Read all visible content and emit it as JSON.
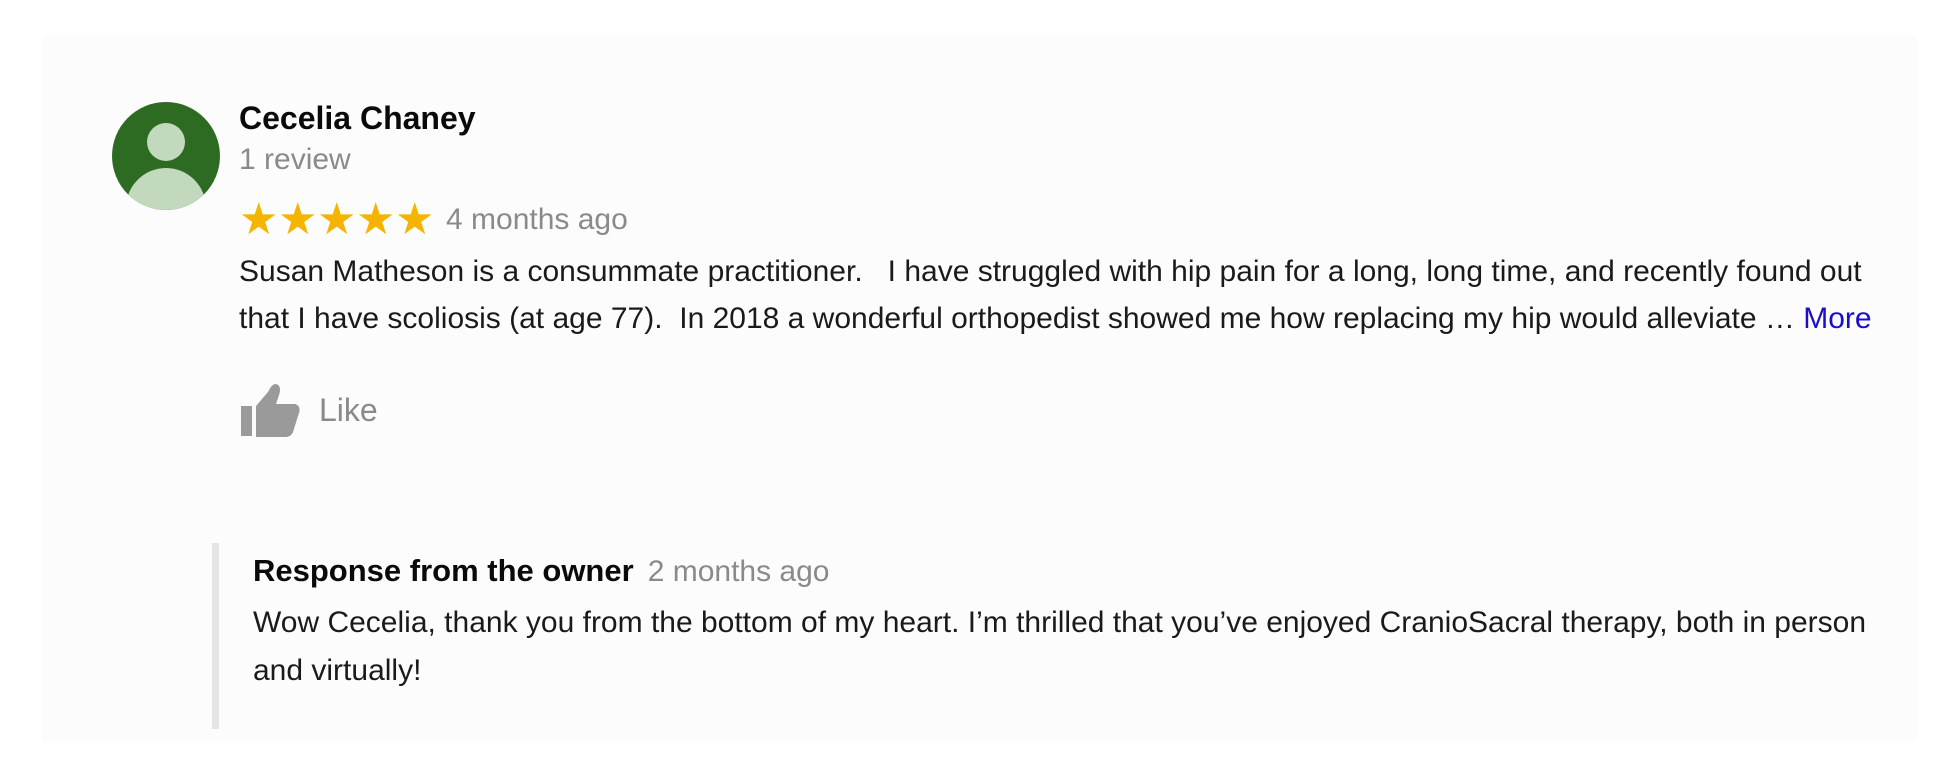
{
  "review": {
    "reviewer_name": "Cecelia Chaney",
    "review_count": "1 review",
    "rating": 5,
    "stars": [
      "★",
      "★",
      "★",
      "★",
      "★"
    ],
    "star_color": "#f5b400",
    "time_ago": "4 months ago",
    "text": "Susan Matheson is a consummate practitioner.   I have struggled with hip pain for a long, long time, and recently found out that I have scoliosis (at age 77).  In 2018 a wonderful orthopedist showed me how replacing my hip would alleviate … ",
    "more_label": "More",
    "like_label": "Like",
    "avatar_icon": "person-icon",
    "avatar_color": "#2e6b22"
  },
  "owner_response": {
    "title": "Response from the owner",
    "time_ago": "2 months ago",
    "text": "Wow Cecelia, thank you from the bottom of my heart. I’m thrilled that you’ve enjoyed CranioSacral therapy, both in person and virtually!"
  }
}
